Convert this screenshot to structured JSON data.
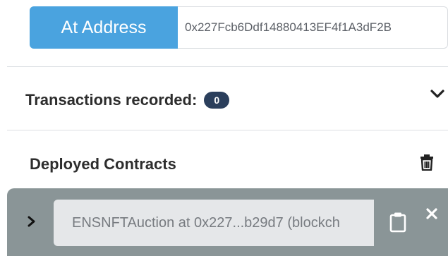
{
  "address_row": {
    "button_label": "At Address",
    "input_value": "0x227Fcb6Ddf14880413EF4f1A3dF2B"
  },
  "transactions": {
    "label": "Transactions recorded:",
    "count": "0"
  },
  "deployed": {
    "label": "Deployed Contracts",
    "instance_label": "ENSNFTAuction at 0x227...b29d7 (blockch"
  },
  "icons": {
    "expand": "chevron-down-icon",
    "clear": "trash-icon",
    "instance_toggle": "chevron-right-icon",
    "copy": "clipboard-icon",
    "remove": "close-icon"
  },
  "colors": {
    "accent": "#4aa3df",
    "badge": "#2b3f5c",
    "instance_bar": "#8a9597"
  }
}
